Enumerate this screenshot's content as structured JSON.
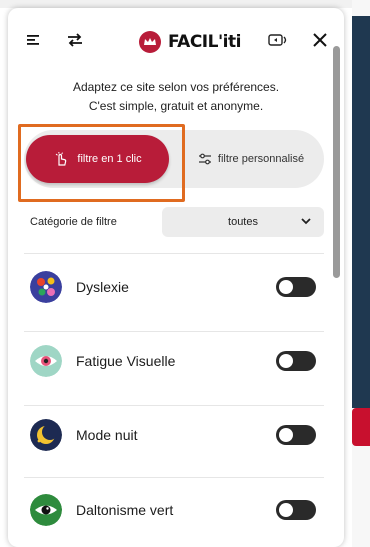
{
  "header": {
    "brand": "FACIL'iti",
    "icons": [
      "menu-icon",
      "swap-icon",
      "logo-icon",
      "voice-icon",
      "close-icon"
    ]
  },
  "tagline": {
    "line1": "Adaptez ce site selon vos préférences.",
    "line2": "C'est simple, gratuit et anonyme."
  },
  "filter_mode": {
    "quick_label": "filtre en 1 clic",
    "custom_label": "filtre personnalisé"
  },
  "category": {
    "label": "Catégorie de filtre",
    "selected": "toutes"
  },
  "filters": [
    {
      "label": "Dyslexie",
      "enabled": false
    },
    {
      "label": "Fatigue Visuelle",
      "enabled": false
    },
    {
      "label": "Mode nuit",
      "enabled": false
    },
    {
      "label": "Daltonisme vert",
      "enabled": false
    }
  ],
  "colors": {
    "brand": "#b81c39",
    "highlight_frame": "#e06b20",
    "toggle_off": "#2a2a2a"
  }
}
